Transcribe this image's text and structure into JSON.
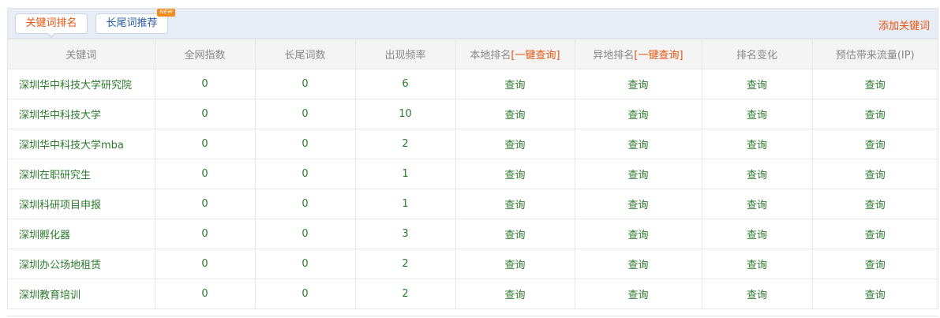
{
  "tabs": {
    "keyword_rank": "关键词排名",
    "longtail_recommend": "长尾词推荐",
    "new_badge": "NEW"
  },
  "add_keyword": "添加关键词",
  "table": {
    "headers": {
      "keyword": "关键词",
      "index": "全网指数",
      "longtail": "长尾词数",
      "frequency": "出现频率",
      "local_rank": "本地排名",
      "local_oneclick": "[一键查询]",
      "remote_rank": "异地排名",
      "remote_oneclick": "[一键查询]",
      "rank_change": "排名变化",
      "traffic": "预估带来流量(IP)"
    },
    "rows": [
      {
        "keyword": "深圳华中科技大学研究院",
        "index": "0",
        "longtail": "0",
        "frequency": "6",
        "local": "查询",
        "remote": "查询",
        "change": "查询",
        "traffic": "查询"
      },
      {
        "keyword": "深圳华中科技大学",
        "index": "0",
        "longtail": "0",
        "frequency": "10",
        "local": "查询",
        "remote": "查询",
        "change": "查询",
        "traffic": "查询"
      },
      {
        "keyword": "深圳华中科技大学mba",
        "index": "0",
        "longtail": "0",
        "frequency": "2",
        "local": "查询",
        "remote": "查询",
        "change": "查询",
        "traffic": "查询"
      },
      {
        "keyword": "深圳在职研究生",
        "index": "0",
        "longtail": "0",
        "frequency": "1",
        "local": "查询",
        "remote": "查询",
        "change": "查询",
        "traffic": "查询"
      },
      {
        "keyword": "深圳科研项目申报",
        "index": "0",
        "longtail": "0",
        "frequency": "1",
        "local": "查询",
        "remote": "查询",
        "change": "查询",
        "traffic": "查询"
      },
      {
        "keyword": "深圳孵化器",
        "index": "0",
        "longtail": "0",
        "frequency": "3",
        "local": "查询",
        "remote": "查询",
        "change": "查询",
        "traffic": "查询"
      },
      {
        "keyword": "深圳办公场地租赁",
        "index": "0",
        "longtail": "0",
        "frequency": "2",
        "local": "查询",
        "remote": "查询",
        "change": "查询",
        "traffic": "查询"
      },
      {
        "keyword": "深圳教育培训",
        "index": "0",
        "longtail": "0",
        "frequency": "2",
        "local": "查询",
        "remote": "查询",
        "change": "查询",
        "traffic": "查询"
      }
    ]
  },
  "colors": {
    "accent_orange": "#e8540f",
    "link_blue": "#2a5ea8",
    "value_green": "#2c7a2c",
    "tabbar_bg": "#e8edf5",
    "header_bg": "#f4f4f4"
  }
}
